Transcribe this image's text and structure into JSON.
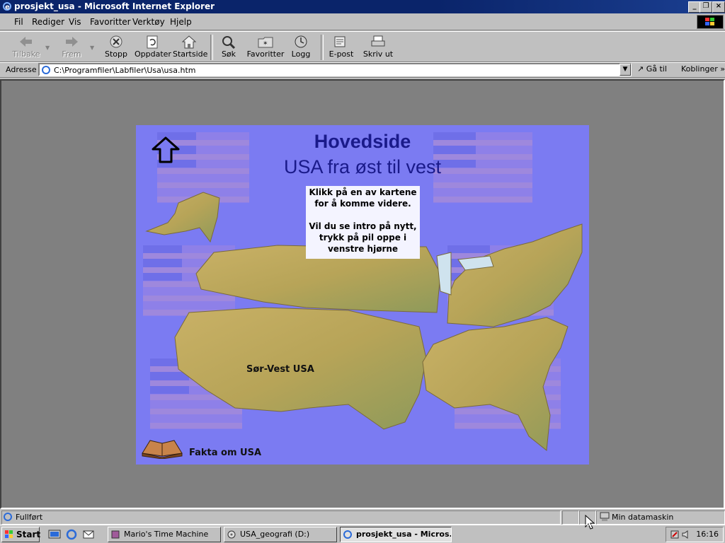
{
  "window": {
    "title": "prosjekt_usa - Microsoft Internet Explorer"
  },
  "menu": [
    "Fil",
    "Rediger",
    "Vis",
    "Favoritter",
    "Verktøy",
    "Hjelp"
  ],
  "toolbar": {
    "back": "Tilbake",
    "forward": "Frem",
    "stop": "Stopp",
    "refresh": "Oppdater",
    "home": "Startside",
    "search": "Søk",
    "favorites": "Favoritter",
    "history": "Logg",
    "mail": "E-post",
    "print": "Skriv ut"
  },
  "address": {
    "label": "Adresse",
    "value": "C:\\Programfiler\\Labfiler\\Usa\\usa.htm",
    "go": "Gå til",
    "links": "Koblinger"
  },
  "page": {
    "title": "Hovedside",
    "subtitle": "USA fra øst til vest",
    "instructions_1": "Klikk på en av kartene for å komme videre.",
    "instructions_2": "Vil du se intro på nytt, trykk på pil oppe i venstre hjørne",
    "map_label": "Sør-Vest USA",
    "facts_link": "Fakta om USA"
  },
  "status": {
    "text": "Fullført",
    "zone": "Min datamaskin"
  },
  "taskbar": {
    "start": "Start",
    "tasks": [
      "Mario's Time Machine",
      "USA_geografi (D:)",
      "prosjekt_usa - Micros..."
    ],
    "clock": "16:16"
  },
  "colors": {
    "page_bg": "#7b7bf2",
    "title_text": "#1a1a8a",
    "titlebar": "#0a246a"
  }
}
